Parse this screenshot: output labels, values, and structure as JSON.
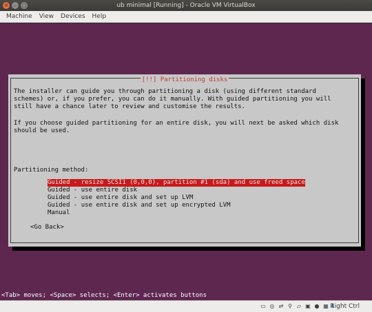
{
  "window": {
    "title": "ub minimal [Running] - Oracle VM VirtualBox"
  },
  "menubar": {
    "items": [
      "Machine",
      "View",
      "Devices",
      "Help"
    ]
  },
  "dialog": {
    "title": "[!!] Partitioning disks",
    "intro": "The installer can guide you through partitioning a disk (using different standard\nschemes) or, if you prefer, you can do it manually. With guided partitioning you will\nstill have a chance later to review and customise the results.",
    "guided_note": "If you choose guided partitioning for an entire disk, you will next be asked which disk\nshould be used.",
    "method_label": "Partitioning method:",
    "options": [
      "Guided - resize SCSI1 (0,0,0), partition #1 (sda) and use freed space",
      "Guided - use entire disk",
      "Guided - use entire disk and set up LVM",
      "Guided - use entire disk and set up encrypted LVM",
      "Manual"
    ],
    "selected_index": 0,
    "go_back": "<Go Back>"
  },
  "hint": "<Tab> moves; <Space> selects; <Enter> activates buttons",
  "statusbar": {
    "icons": [
      "hard-disk-icon",
      "optical-drive-icon",
      "network-icon",
      "usb-icon",
      "shared-folder-icon",
      "display-icon",
      "recording-icon",
      "cpu-icon"
    ],
    "host_key": "Right Ctrl"
  },
  "colors": {
    "guest_background": "#5e2750",
    "dialog_background": "#c8c8c8",
    "selection": "#c8191a",
    "title_text": "#c0392b"
  }
}
